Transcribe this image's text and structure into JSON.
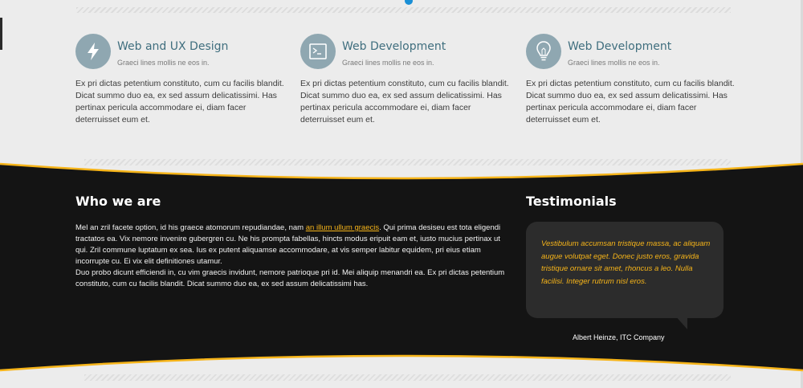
{
  "features": [
    {
      "icon": "lightning-icon",
      "title": "Web and UX Design",
      "subtitle": "Graeci lines mollis ne eos in.",
      "body": "Ex pri dictas petentium constituto, cum cu facilis blandit. Dicat summo duo ea, ex sed assum delicatissimi. Has pertinax pericula accommodare ei, diam facer deterruisset eum et."
    },
    {
      "icon": "terminal-icon",
      "title": "Web Development",
      "subtitle": "Graeci lines mollis ne eos in.",
      "body": "Ex pri dictas petentium constituto, cum cu facilis blandit. Dicat summo duo ea, ex sed assum delicatissimi. Has pertinax pericula accommodare ei, diam facer deterruisset eum et."
    },
    {
      "icon": "lightbulb-icon",
      "title": "Web Development",
      "subtitle": "Graeci lines mollis ne eos in.",
      "body": "Ex pri dictas petentium constituto, cum cu facilis blandit. Dicat summo duo ea, ex sed assum delicatissimi. Has pertinax pericula accommodare ei, diam facer deterruisset eum et."
    }
  ],
  "who": {
    "title": "Who we are",
    "p1_before": "Mel an zril facete option, id his graece atomorum repudiandae, nam ",
    "p1_link": "an illum ullum graecis",
    "p1_after": ". Qui prima desiseu est tota eligendi tractatos ea. Vix nemore invenire gubergren cu. Ne his prompta fabellas, hincts modus eripuit eam et, iusto mucius pertinax ut qui. Zril commune luptatum ex sea. Ius ex putent aliquamse accommodare, at vis semper labitur equidem, pri eius etiam incorrupte cu. Ei vix elit definitiones utamur.",
    "p2": "Duo probo dicunt efficiendi in, cu vim graecis invidunt, nemore patrioque pri id. Mei aliquip menandri ea. Ex pri dictas petentium constituto, cum cu facilis blandit. Dicat summo duo ea, ex sed assum delicatissimi has."
  },
  "testimonials": {
    "title": "Testimonials",
    "quote": "Vestibulum accumsan tristique massa, ac aliquam augue volutpat eget. Donec justo eros, gravida tristique ornare sit amet, rhoncus a leo. Nulla facilisi. Integer rutrum nisl eros.",
    "author": "Albert Heinze, ITC Company"
  },
  "colors": {
    "accent": "#f6b419",
    "band": "#141414",
    "icon_circle": "#8fa7b1",
    "feature_title": "#3f6e7e",
    "highlight_dot": "#1a8fd6"
  }
}
